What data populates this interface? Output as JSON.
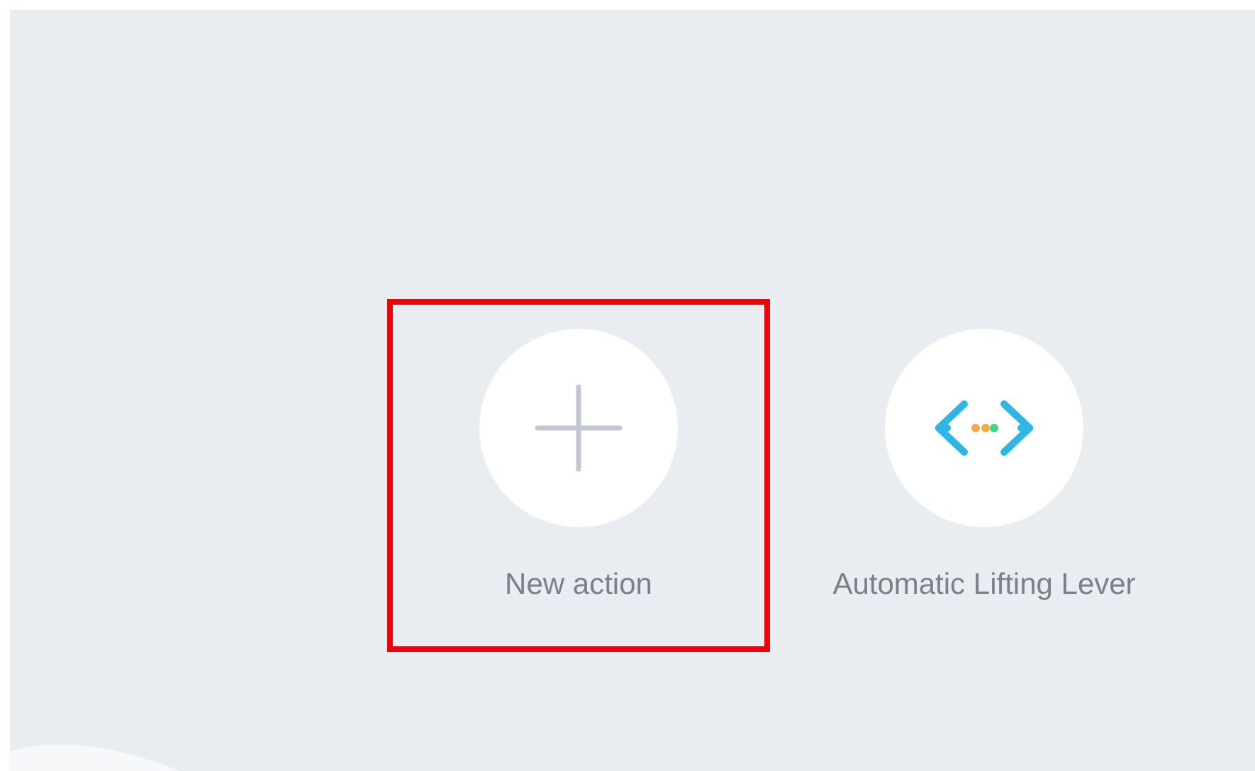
{
  "actions": [
    {
      "kind": "add",
      "label": "New action",
      "highlighted": true
    },
    {
      "kind": "flow",
      "label": "Automatic Lifting Lever",
      "highlighted": false
    }
  ]
}
